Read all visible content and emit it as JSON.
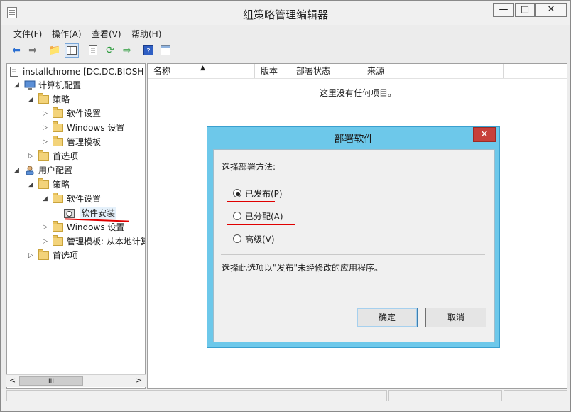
{
  "window": {
    "title": "组策略管理编辑器",
    "min_label": "—",
    "max_label": "□",
    "close_label": "✕"
  },
  "menu": [
    "文件(F)",
    "操作(A)",
    "查看(V)",
    "帮助(H)"
  ],
  "toolbar": [
    "back-icon",
    "forward-icon",
    "up-folder-icon",
    "show-hide-tree-icon",
    "properties-icon",
    "refresh-icon",
    "export-icon",
    "help-icon",
    "view-icon"
  ],
  "tree": {
    "root": "installchrome [DC.DC.BIOSH",
    "computer_config": "计算机配置",
    "policies": "策略",
    "software_settings": "软件设置",
    "windows_settings": "Windows 设置",
    "admin_templates": "管理模板",
    "preferences": "首选项",
    "user_config": "用户配置",
    "user_policies": "策略",
    "user_software_settings": "软件设置",
    "software_install": "软件安装",
    "user_windows_settings": "Windows 设置",
    "user_admin_templates": "管理模板: 从本地计算",
    "user_preferences": "首选项"
  },
  "list": {
    "columns": [
      "名称",
      "版本",
      "部署状态",
      "来源"
    ],
    "empty_text": "这里没有任何项目。"
  },
  "scrollbar": {
    "left": "<",
    "right": ">",
    "thumb": "III"
  },
  "dialog": {
    "title": "部署软件",
    "close": "✕",
    "prompt": "选择部署方法:",
    "options": [
      "已发布(P)",
      "已分配(A)",
      "高级(V)"
    ],
    "selected": 0,
    "description": "选择此选项以\"发布\"未经修改的应用程序。",
    "ok": "确定",
    "cancel": "取消"
  },
  "colors": {
    "dialog_frame": "#6dc8ea",
    "close_button": "#c7403a",
    "annotation": "#e00000"
  }
}
